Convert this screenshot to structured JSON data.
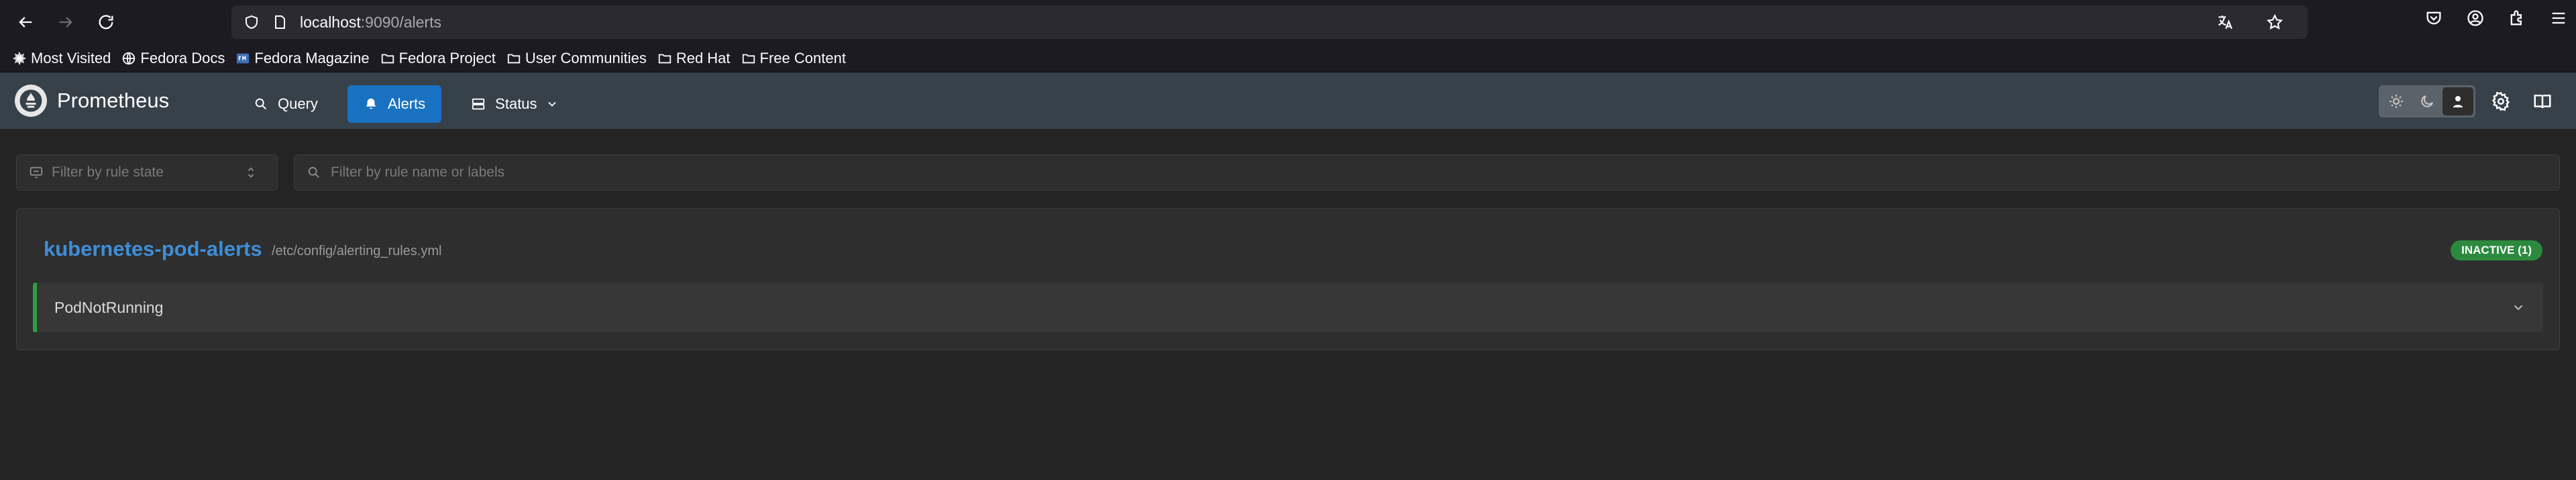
{
  "browser": {
    "url_host": "localhost",
    "url_path": ":9090/alerts",
    "bookmarks": [
      "Most Visited",
      "Fedora Docs",
      "Fedora Magazine",
      "Fedora Project",
      "User Communities",
      "Red Hat",
      "Free Content"
    ]
  },
  "app": {
    "name": "Prometheus",
    "nav": {
      "query": "Query",
      "alerts": "Alerts",
      "status": "Status"
    }
  },
  "filters": {
    "state_placeholder": "Filter by rule state",
    "search_placeholder": "Filter by rule name or labels"
  },
  "group": {
    "name": "kubernetes-pod-alerts",
    "file": "/etc/config/alerting_rules.yml",
    "badge": "INACTIVE (1)",
    "rules": [
      {
        "name": "PodNotRunning"
      }
    ]
  },
  "colors": {
    "accent": "#1971c2",
    "inactive": "#2b8a3e",
    "title": "#3d8ed8"
  }
}
